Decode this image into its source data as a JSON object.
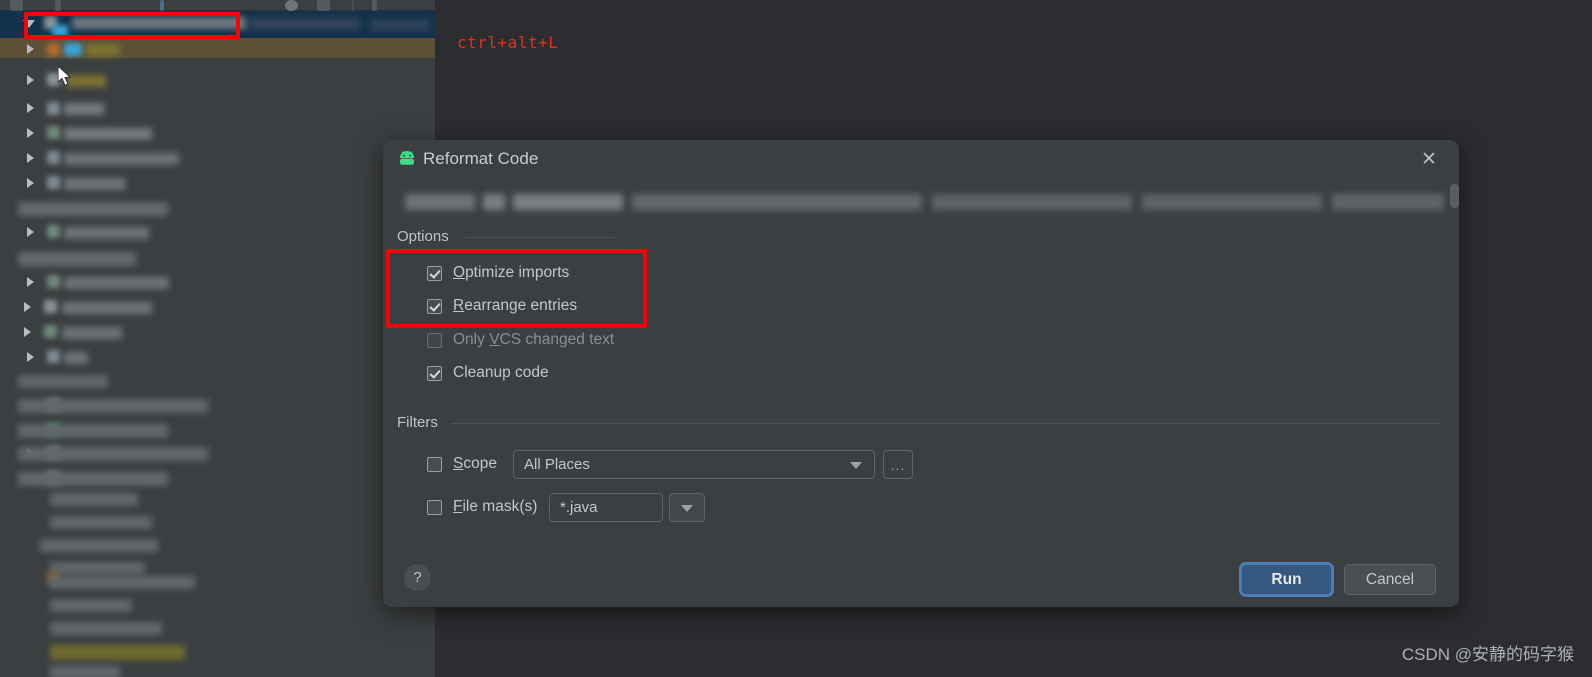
{
  "window": {
    "editor_code_line": "ctrl+alt+L",
    "watermark": "CSDN @安静的码字猴"
  },
  "dialog": {
    "title": "Reformat Code",
    "icon": "android-robot-icon",
    "close_icon": "✕",
    "path_value": "",
    "options": {
      "group_label": "Options",
      "items": [
        {
          "label": "Optimize imports",
          "mnemonic": "O",
          "rest": "ptimize imports",
          "checked": true,
          "disabled": false
        },
        {
          "label": "Rearrange entries",
          "mnemonic": "R",
          "rest": "earrange entries",
          "checked": true,
          "disabled": false
        },
        {
          "label": "Only VCS changed text",
          "pre": "Only ",
          "mnemonic": "V",
          "rest": "CS changed text",
          "checked": false,
          "disabled": true
        },
        {
          "label": "Cleanup code",
          "pre": "Cleanup code",
          "mnemonic": "",
          "rest": "",
          "checked": true,
          "disabled": false
        }
      ]
    },
    "filters": {
      "group_label": "Filters",
      "scope": {
        "label_pre": "",
        "mnemonic": "S",
        "label_rest": "cope",
        "checked": false,
        "value": "All Places",
        "more_button": "...",
        "dropdown_icon": "chevron-down-icon"
      },
      "file_mask": {
        "label_pre": "",
        "mnemonic": "F",
        "label_rest": "ile mask(s)",
        "checked": false,
        "value": "*.java",
        "dropdown_icon": "chevron-down-icon"
      }
    },
    "footer": {
      "help_label": "?",
      "run_label": "Run",
      "cancel_label": "Cancel"
    }
  },
  "colors": {
    "dialog_bg": "#3c3f41",
    "primary_button": "#365880",
    "annotation_red": "#fb0007",
    "code_red": "#e0301e",
    "android_green": "#3ddc84"
  }
}
